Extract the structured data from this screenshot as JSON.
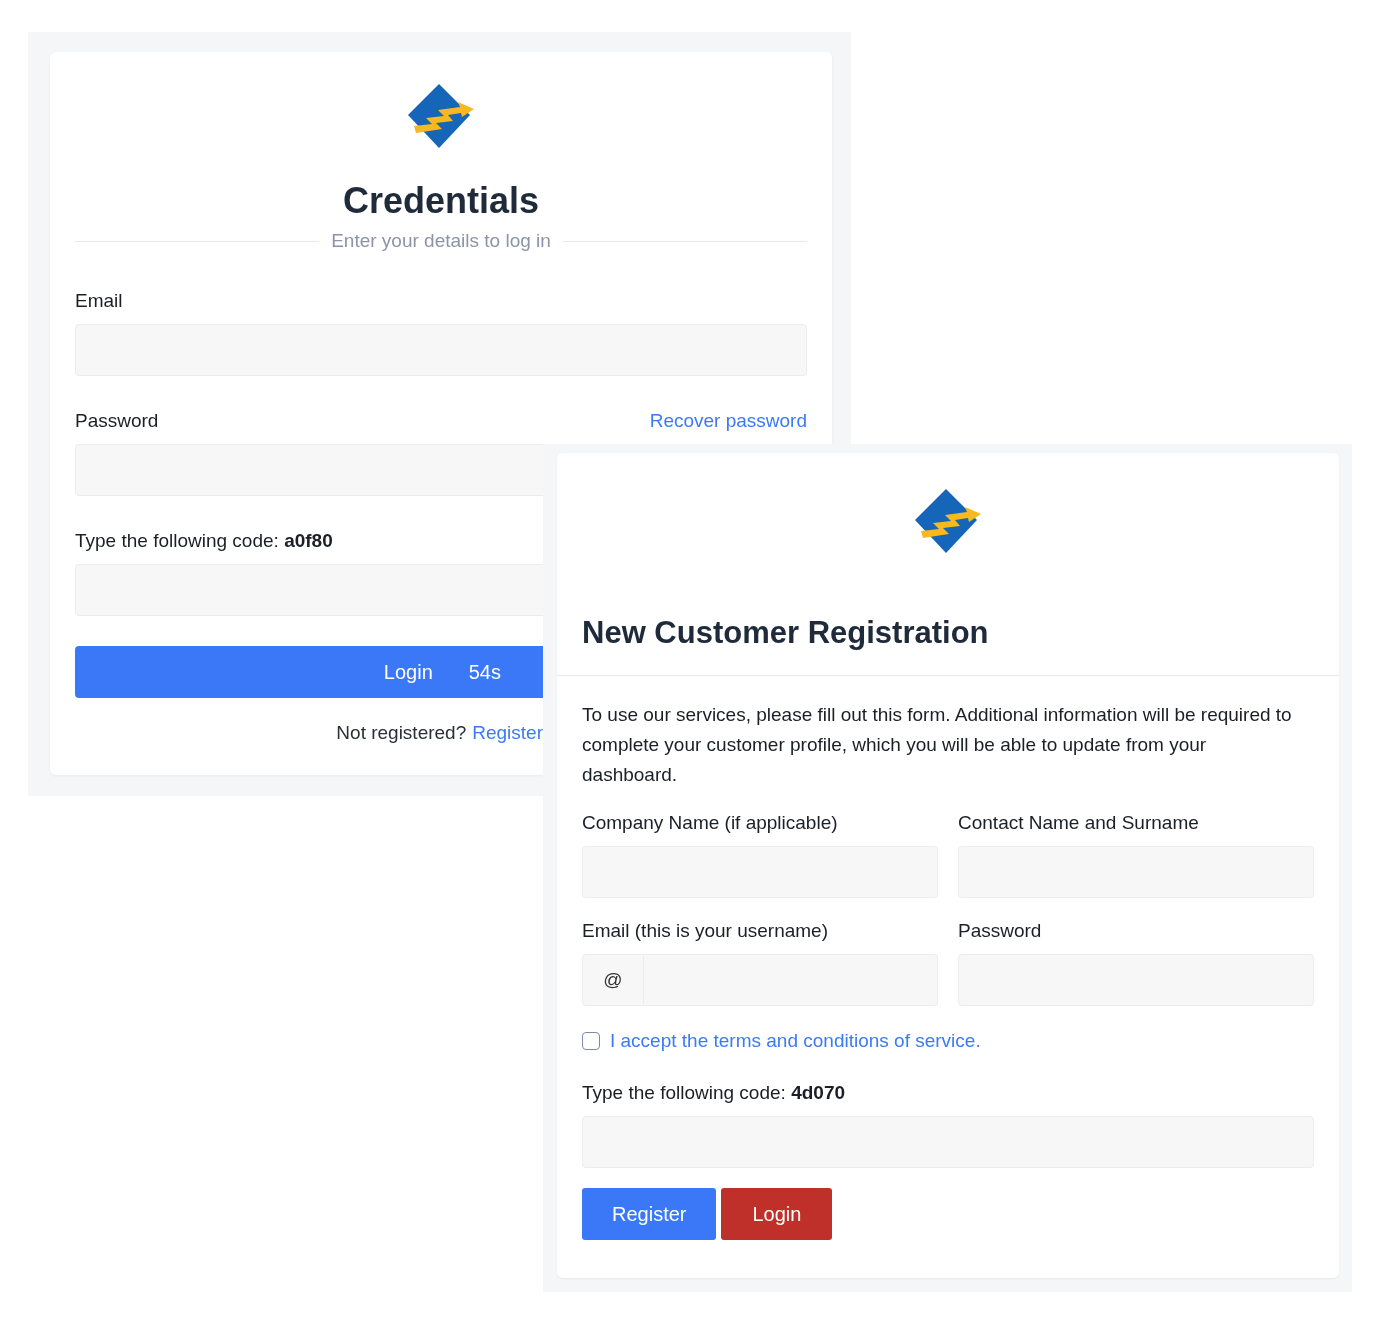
{
  "login": {
    "title": "Credentials",
    "subtitle": "Enter your details to log in",
    "email": {
      "label": "Email"
    },
    "password": {
      "label": "Password",
      "link": "Recover password"
    },
    "code": {
      "label": "Type the following code: **a0f80**"
    },
    "button": {
      "label": "Login",
      "timer": "54s"
    },
    "footer": {
      "text": "Not registered?",
      "link": "Register"
    }
  },
  "register": {
    "title": "New Customer Registration",
    "intro": "To use our services, please fill out this form. Additional information will be required to complete your customer profile, which you will be able to update from your dashboard.",
    "fields": [
      {
        "label": "Company Name (if applicable)",
        "kind": "text"
      },
      {
        "label": "Contact Name and Surname",
        "kind": "text"
      },
      {
        "label": "Email (this is your username)",
        "kind": "addon",
        "addon": "@"
      },
      {
        "label": "Password",
        "kind": "text"
      }
    ],
    "terms": {
      "label": "I accept the terms and conditions of service.",
      "checked": false
    },
    "code": {
      "label": "Type the following code: **4d070**"
    },
    "buttons": [
      {
        "label": "Register",
        "kind": "primary"
      },
      {
        "label": "Login",
        "kind": "danger"
      }
    ]
  }
}
